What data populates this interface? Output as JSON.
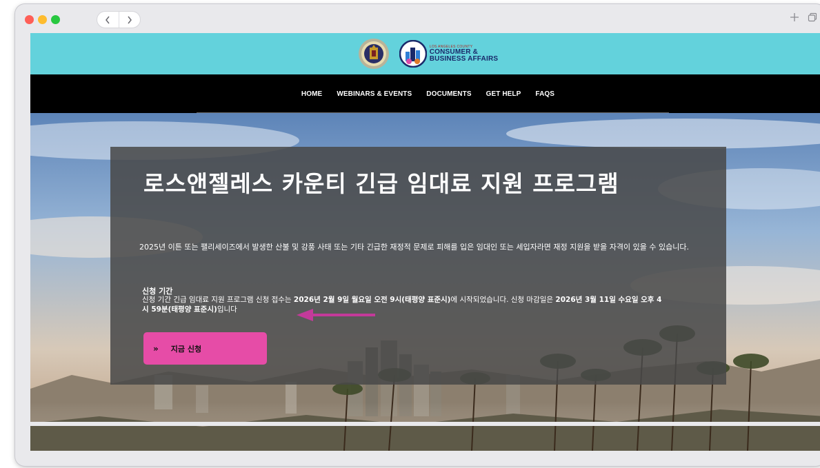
{
  "window": {
    "nav": {
      "back_icon": "chevron-left-icon",
      "forward_icon": "chevron-right-icon"
    },
    "actions": {
      "new_tab_icon": "plus-icon",
      "tabs_icon": "tabs-icon"
    }
  },
  "header": {
    "seal_icon": "county-seal-icon",
    "dcba": {
      "line1": "LOS ANGELES COUNTY",
      "line2": "CONSUMER &",
      "line3": "BUSINESS AFFAIRS"
    }
  },
  "nav": {
    "items": [
      "HOME",
      "WEBINARS & EVENTS",
      "DOCUMENTS",
      "GET HELP",
      "FAQS"
    ]
  },
  "hero": {
    "title": "로스앤젤레스 카운티 긴급 임대료 지원 프로그램",
    "subtitle": "2025년 이튼 또는 팰리세이즈에서 발생한 산불 및 강풍 사태 또는 기타 긴급한 재정적 문제로 피해를 입은 임대인 또는 세입자라면 재정 지원을 받을 자격이 있을 수 있습니다.",
    "period_label": "신청 기간",
    "period_text_1": "신청 기간 긴급 임대료 지원 프로그램 신청 접수는 ",
    "period_bold_1": "2026년 2월 9일 월요일 오전 9시(태평양 표준시)",
    "period_text_2": "에 시작되었습니다. 신청 마감일은 ",
    "period_bold_2": "2026년 3월 11일 수요일 오후 4시 59분(태평양 표준시)",
    "period_text_3": "입니다",
    "apply_button": "지금 신청",
    "apply_icon": "double-chevron-right-icon"
  },
  "colors": {
    "logo_bar": "#63d2dc",
    "nav_bar": "#000000",
    "button": "#e64ca7",
    "arrow": "#c43a9a"
  }
}
